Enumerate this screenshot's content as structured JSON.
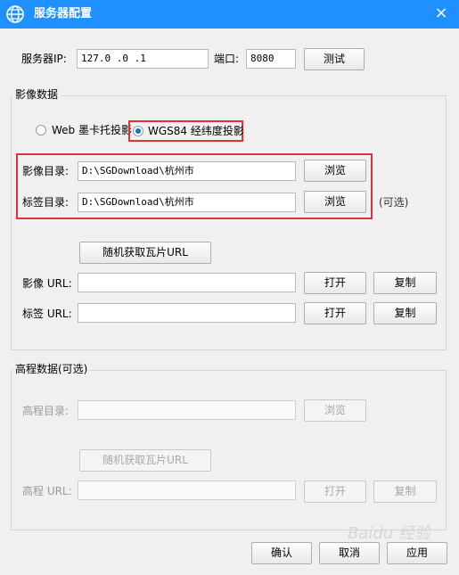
{
  "window": {
    "title": "服务器配置",
    "close_glyph": "×"
  },
  "server": {
    "ip_label": "服务器IP:",
    "ip_value": "127.0  .0  .1",
    "port_label": "端口:",
    "port_value": "8080",
    "test_button": "测试"
  },
  "imagery": {
    "group_title": "影像数据",
    "projection_options": [
      {
        "label": "Web 墨卡托投影",
        "selected": false
      },
      {
        "label": "WGS84 经纬度投影",
        "selected": true
      }
    ],
    "image_dir_label": "影像目录:",
    "image_dir_value": "D:\\SGDownload\\杭州市",
    "label_dir_label": "标签目录:",
    "label_dir_value": "D:\\SGDownload\\杭州市",
    "browse_button": "浏览",
    "optional_note": "(可选)",
    "random_url_button": "随机获取瓦片URL",
    "image_url_label": "影像 URL:",
    "image_url_value": "",
    "label_url_label": "标签 URL:",
    "label_url_value": "",
    "open_button": "打开",
    "copy_button": "复制"
  },
  "elevation": {
    "group_title": "高程数据(可选)",
    "dir_label": "高程目录:",
    "dir_value": "",
    "browse_button": "浏览",
    "random_url_button": "随机获取瓦片URL",
    "url_label": "高程 URL:",
    "url_value": "",
    "open_button": "打开",
    "copy_button": "复制"
  },
  "footer": {
    "ok_button": "确认",
    "cancel_button": "取消",
    "apply_button": "应用"
  },
  "watermark": "Baidu 经验",
  "colors": {
    "titlebar": "#1e90ff",
    "highlight": "#e0303a",
    "radio_dot": "#1d6fc9"
  }
}
